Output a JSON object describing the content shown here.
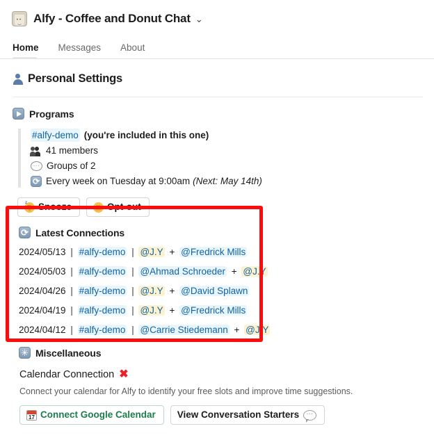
{
  "header": {
    "app_icon": "coffee-cup-icon",
    "title": "Alfy - Coffee and Donut Chat",
    "chevron": "⌄"
  },
  "tabs": [
    {
      "label": "Home",
      "active": true
    },
    {
      "label": "Messages",
      "active": false
    },
    {
      "label": "About",
      "active": false
    }
  ],
  "personal_settings": {
    "title": "Personal Settings",
    "icon": "bust-in-silhouette-icon"
  },
  "programs": {
    "heading": "Programs",
    "heading_icon": "play-button-icon",
    "channel": "#alfy-demo",
    "channel_note": "(you're included in this one)",
    "members": "41 members",
    "members_icon": "busts-in-silhouette-icon",
    "group_size": "Groups of 2",
    "group_icon": "speech-balloon-icon",
    "schedule": "Every week on Tuesday at 9:00am",
    "schedule_next": "(Next: May 14th)",
    "schedule_icon": "repeat-icon",
    "buttons": [
      {
        "label": "Snooze",
        "icon": "sleeping-face-icon"
      },
      {
        "label": "Opt-out",
        "icon": "shushing-face-icon"
      }
    ]
  },
  "latest_connections": {
    "heading": "Latest Connections",
    "heading_icon": "repeat-icon",
    "highlight_color": "#fb0d0d",
    "rows": [
      {
        "date": "2024/05/13",
        "channel": "#alfy-demo",
        "person_a": "@J.Y",
        "person_a_self": true,
        "person_b": "@Fredrick Mills",
        "person_b_self": false
      },
      {
        "date": "2024/05/03",
        "channel": "#alfy-demo",
        "person_a": "@Ahmad Schroeder",
        "person_a_self": false,
        "person_b": "@J.Y",
        "person_b_self": true
      },
      {
        "date": "2024/04/26",
        "channel": "#alfy-demo",
        "person_a": "@J.Y",
        "person_a_self": true,
        "person_b": "@David Splawn",
        "person_b_self": false
      },
      {
        "date": "2024/04/19",
        "channel": "#alfy-demo",
        "person_a": "@J.Y",
        "person_a_self": true,
        "person_b": "@Fredrick Mills",
        "person_b_self": false
      },
      {
        "date": "2024/04/12",
        "channel": "#alfy-demo",
        "person_a": "@Carrie Stiedemann",
        "person_a_self": false,
        "person_b": "@J.Y",
        "person_b_self": true
      }
    ],
    "separator": "|",
    "plus": "+"
  },
  "miscellaneous": {
    "heading": "Miscellaneous",
    "heading_icon": "asterisk-icon",
    "calendar_status_label": "Calendar Connection",
    "calendar_status_icon": "red-x-icon",
    "calendar_status_mark": "✖",
    "description": "Connect your calendar for Alfy to identify your free slots and improve time suggestions.",
    "buttons": [
      {
        "label": "Connect Google Calendar",
        "icon": "calendar-icon",
        "color": "#1a7f4b",
        "day": "17"
      },
      {
        "label": "View Conversation Starters",
        "icon": "speech-balloon-icon"
      }
    ]
  }
}
